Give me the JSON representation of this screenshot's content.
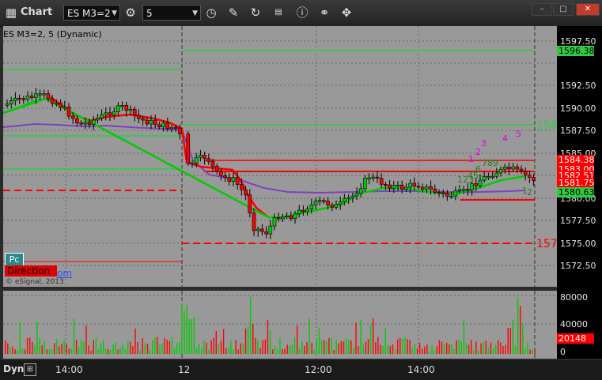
{
  "toolbar": {
    "title": "Chart",
    "symbol": "ES M3=2",
    "interval": "5",
    "icons": [
      "chart-grid-icon",
      "gear-icon",
      "clock-icon",
      "pencil-icon",
      "refresh-icon",
      "quote-icon",
      "info-icon",
      "link-icon",
      "move-icon"
    ]
  },
  "window_controls": [
    "minimize",
    "maximize",
    "close"
  ],
  "legend": {
    "label": "ES M3=2, 5 (Dynamic)"
  },
  "pc_label": "Pc",
  "direction_label": "Direction",
  "om_link": "om",
  "copyright": "© eSignal, 2013",
  "price_axis": [
    "1597.50",
    "1595.00",
    "1592.50",
    "1590.00",
    "1587.50",
    "1585.00",
    "1582.50",
    "1580.00",
    "1577.50",
    "1575.00",
    "1572.50"
  ],
  "volume_axis": [
    "80000",
    "40000",
    "0"
  ],
  "tags": [
    {
      "text": "1596.38",
      "bg": "#2ecc40",
      "fg": "#000"
    },
    {
      "text": "1584.38",
      "bg": "#ff0000",
      "fg": "#fff"
    },
    {
      "text": "1583.00",
      "bg": "#ff0000",
      "fg": "#fff"
    },
    {
      "text": "1582.51",
      "bg": "#ff0000",
      "fg": "#fff"
    },
    {
      "text": "1581.75",
      "bg": "#ff0000",
      "fg": "#fff"
    },
    {
      "text": "1580.63",
      "bg": "#2ecc40",
      "fg": "#000"
    },
    {
      "text": "20148",
      "bg": "#ff0000",
      "fg": "#fff"
    }
  ],
  "level_labels": {
    "upper": "158",
    "lower": "157"
  },
  "count_labels": {
    "magenta": [
      "1",
      "2",
      "3",
      "4",
      "5"
    ],
    "green": [
      "123",
      "45",
      "6",
      "789",
      "1",
      "2"
    ]
  },
  "time_axis": [
    "14:00",
    "12",
    "12:00",
    "14:00"
  ],
  "dyn_label": "Dyn",
  "colors": {
    "bg": "#999999",
    "up": "#00cc00",
    "down": "#ff0000",
    "ma": "#8040c0"
  }
}
